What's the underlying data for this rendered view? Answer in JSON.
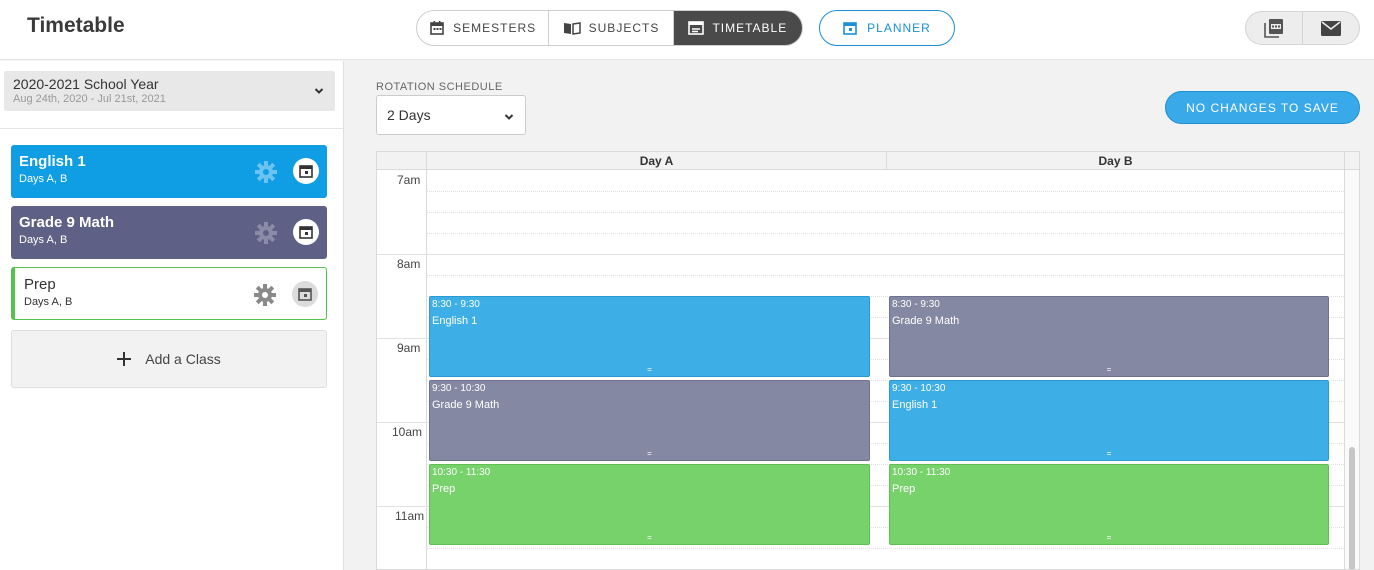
{
  "header": {
    "title": "Timetable",
    "tabs": [
      {
        "label": "SEMESTERS",
        "icon": "calendar-icon"
      },
      {
        "label": "SUBJECTS",
        "icon": "book-icon"
      },
      {
        "label": "TIMETABLE",
        "icon": "timetable-icon",
        "active": true
      }
    ],
    "planner_label": "PLANNER",
    "tools": [
      {
        "icon": "pdf-icon"
      },
      {
        "icon": "mail-icon"
      }
    ]
  },
  "sidebar": {
    "school_year": {
      "title": "2020-2021 School Year",
      "dates": "Aug 24th, 2020 - Jul 21st, 2021"
    },
    "classes": [
      {
        "name": "English 1",
        "days": "Days A, B",
        "color": "#0f9de3"
      },
      {
        "name": "Grade 9 Math",
        "days": "Days A, B",
        "color": "#5e6185"
      },
      {
        "name": "Prep",
        "days": "Days A, B",
        "color": "#55c24c"
      }
    ],
    "add_class_label": "Add a Class"
  },
  "main": {
    "rotation_label": "ROTATION SCHEDULE",
    "rotation_value": "2 Days",
    "save_label": "NO CHANGES TO SAVE",
    "days": [
      "Day A",
      "Day B"
    ],
    "times": [
      "7am",
      "8am",
      "9am",
      "10am",
      "11am"
    ],
    "events": {
      "day_a": [
        {
          "time": "8:30 - 9:30",
          "name": "English 1",
          "color": "#3eaee6"
        },
        {
          "time": "9:30 - 10:30",
          "name": "Grade 9 Math",
          "color": "#8588a3"
        },
        {
          "time": "10:30 - 11:30",
          "name": "Prep",
          "color": "#78d26c"
        }
      ],
      "day_b": [
        {
          "time": "8:30 - 9:30",
          "name": "Grade 9 Math",
          "color": "#8588a3"
        },
        {
          "time": "9:30 - 10:30",
          "name": "English 1",
          "color": "#3eaee6"
        },
        {
          "time": "10:30 - 11:30",
          "name": "Prep",
          "color": "#78d26c"
        }
      ]
    },
    "handle_glyph": "="
  },
  "colors": {
    "accent": "#1c8fd6",
    "active_tab": "#4a4a4a"
  }
}
